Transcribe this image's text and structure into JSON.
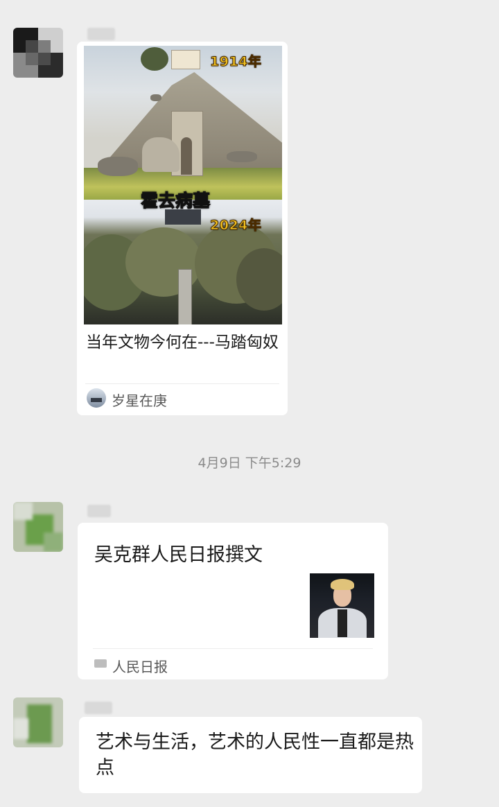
{
  "messages": [
    {
      "type": "link-card",
      "image": {
        "year_top": "1914年",
        "caption": "霍去病墓",
        "year_bottom": "2024年"
      },
      "title": "当年文物今何在---马踏匈奴",
      "source": "岁星在庚"
    },
    {
      "type": "timestamp",
      "text": "4月9日 下午5:29"
    },
    {
      "type": "link-card",
      "title": "吴克群人民日报撰文",
      "source": "人民日报"
    },
    {
      "type": "text",
      "text": "艺术与生活，艺术的人民性一直都是热点"
    }
  ],
  "colors": {
    "background": "#ededed",
    "bubble": "#ffffff",
    "year_label": "#f0c020",
    "timestamp": "#8a8a8a"
  }
}
